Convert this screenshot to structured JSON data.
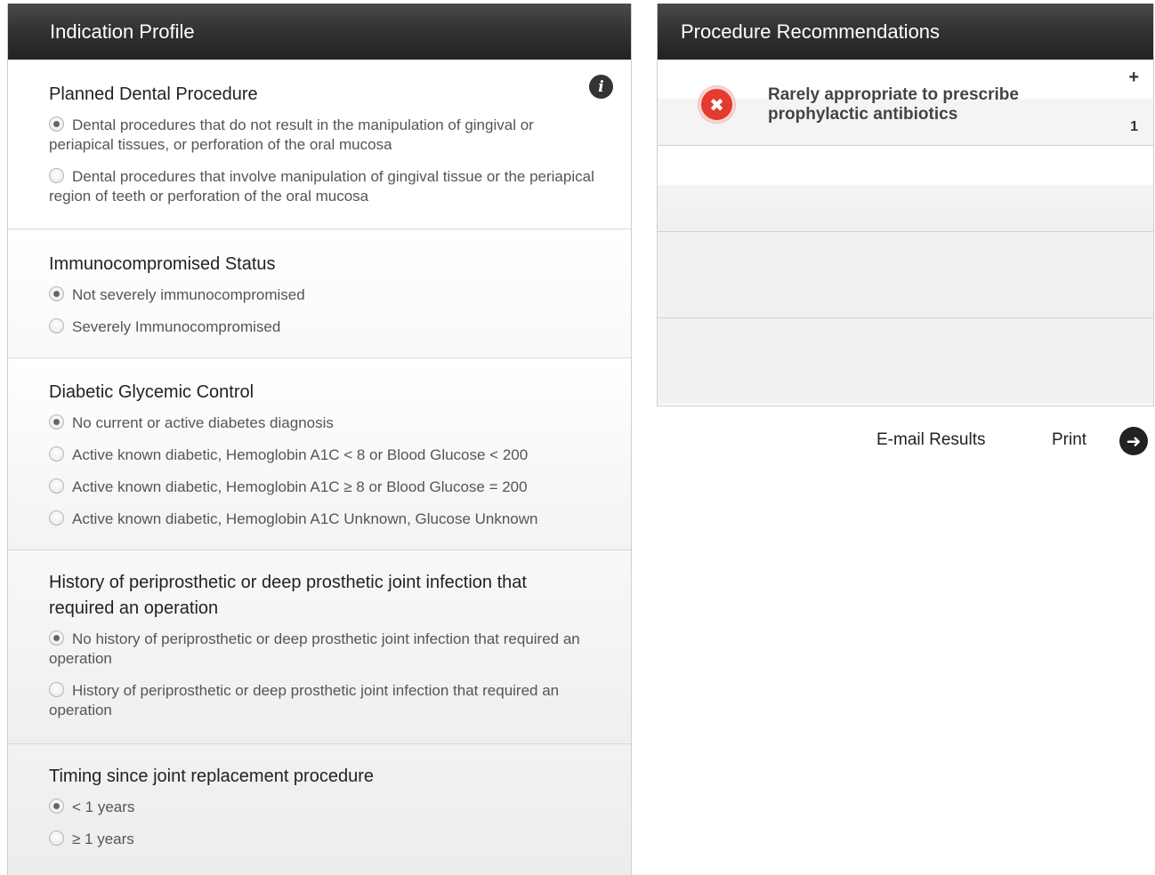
{
  "left_panel": {
    "title": "Indication Profile",
    "info_icon": "info-icon",
    "sections": [
      {
        "title": "Planned Dental Procedure",
        "options": [
          {
            "label": "Dental procedures that do not result in the manipulation of gingival or periapical tissues, or perforation of the oral mucosa",
            "checked": true
          },
          {
            "label": "Dental procedures that involve manipulation of gingival tissue or the periapical region of teeth or perforation of the oral mucosa",
            "checked": false
          }
        ]
      },
      {
        "title": "Immunocompromised Status",
        "options": [
          {
            "label": "Not severely immunocompromised",
            "checked": true
          },
          {
            "label": "Severely Immunocompromised",
            "checked": false
          }
        ]
      },
      {
        "title": "Diabetic Glycemic Control",
        "options": [
          {
            "label": "No current or active diabetes diagnosis",
            "checked": true
          },
          {
            "label": "Active known diabetic, Hemoglobin A1C < 8 or Blood Glucose < 200",
            "checked": false
          },
          {
            "label": "Active known diabetic, Hemoglobin A1C ≥ 8 or Blood Glucose = 200",
            "checked": false
          },
          {
            "label": "Active known diabetic, Hemoglobin A1C Unknown, Glucose Unknown",
            "checked": false
          }
        ]
      },
      {
        "title": "History of periprosthetic or deep prosthetic joint infection that required an operation",
        "options": [
          {
            "label": "No history of periprosthetic or deep prosthetic joint infection that required an operation",
            "checked": true
          },
          {
            "label": "History of periprosthetic or deep prosthetic joint infection that required an operation",
            "checked": false
          }
        ]
      },
      {
        "title": "Timing since joint replacement procedure",
        "options": [
          {
            "label": "< 1 years",
            "checked": true
          },
          {
            "label": "≥ 1 years",
            "checked": false
          }
        ]
      }
    ]
  },
  "right_panel": {
    "title": "Procedure Recommendations",
    "recommendation": {
      "text": "Rarely appropriate to prescribe prophylactic antibiotics",
      "expand_symbol": "+",
      "count": "1",
      "status_icon": "x-circle-icon",
      "status_color": "#e53a2e"
    }
  },
  "actions": {
    "email_label": "E-mail Results",
    "print_label": "Print",
    "arrow_icon": "arrow-right-circle-icon"
  }
}
